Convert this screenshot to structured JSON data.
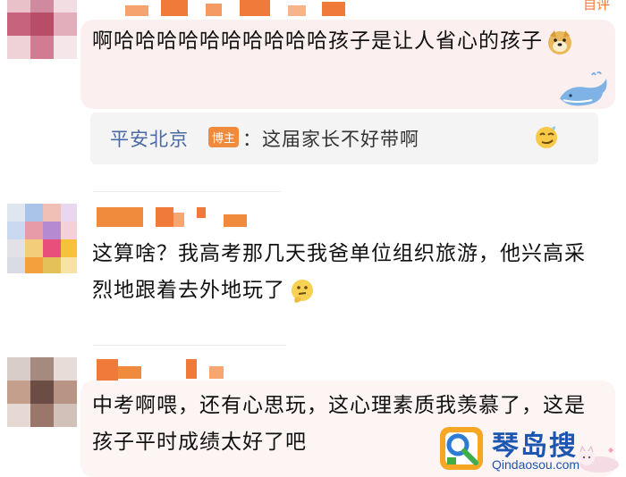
{
  "comments": [
    {
      "text": "啊哈哈哈哈哈哈哈哈哈哈孩子是让人省心的孩子",
      "emoji_icon": "doge-emoji-icon",
      "reply": {
        "author": "平安北京",
        "badge": "博主",
        "text": "：这届家长不好带啊",
        "emoji_icon": "smirk-emoji-icon"
      }
    },
    {
      "text": "这算啥？我高考那几天我爸单位组织旅游，他兴高采烈地跟着去外地玩了",
      "emoji_icon": "thinking-emoji-icon"
    },
    {
      "text": "中考啊喂，还有心思玩，这心理素质我羡慕了，这是孩子平时成绩太好了吧"
    }
  ],
  "header_action": "自评",
  "watermark": {
    "title": "琴岛搜",
    "url": "Qindaosou.com"
  },
  "colors": {
    "bubble": "#fbf0ef",
    "link": "#4a6aa3",
    "badge": "#f08a3c",
    "watermark": "#1c56b0"
  }
}
